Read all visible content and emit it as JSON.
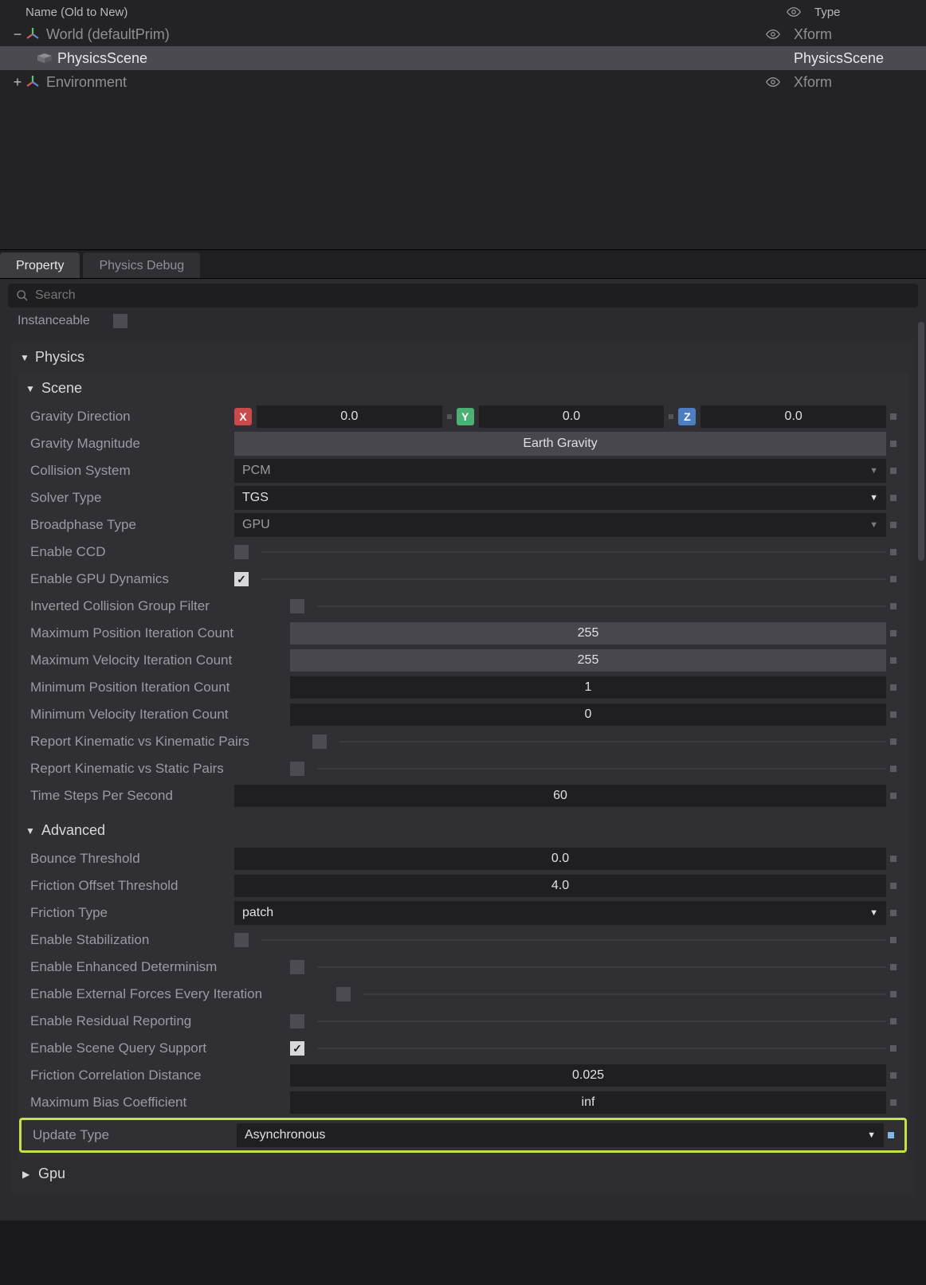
{
  "outliner": {
    "header_name": "Name (Old to New)",
    "header_type": "Type",
    "rows": [
      {
        "label": "World (defaultPrim)",
        "type": "Xform",
        "selected": false,
        "expand": "−",
        "icon": "axes",
        "vis": true
      },
      {
        "label": "PhysicsScene",
        "type": "PhysicsScene",
        "selected": true,
        "expand": "",
        "icon": "cube",
        "vis": false
      },
      {
        "label": "Environment",
        "type": "Xform",
        "selected": false,
        "expand": "+",
        "icon": "axes",
        "vis": true
      }
    ]
  },
  "tabs": {
    "property": "Property",
    "physics_debug": "Physics Debug"
  },
  "search_placeholder": "Search",
  "instanceable_label": "Instanceable",
  "physics_section": "Physics",
  "scene_section": "Scene",
  "gravity_direction": {
    "label": "Gravity Direction",
    "x": "0.0",
    "y": "0.0",
    "z": "0.0"
  },
  "gravity_magnitude": {
    "label": "Gravity Magnitude",
    "button": "Earth Gravity"
  },
  "collision_system": {
    "label": "Collision System",
    "value": "PCM"
  },
  "solver_type": {
    "label": "Solver Type",
    "value": "TGS"
  },
  "broadphase_type": {
    "label": "Broadphase Type",
    "value": "GPU"
  },
  "enable_ccd": {
    "label": "Enable CCD",
    "checked": false
  },
  "enable_gpu_dynamics": {
    "label": "Enable GPU Dynamics",
    "checked": true
  },
  "inverted_collision": {
    "label": "Inverted Collision Group Filter",
    "checked": false
  },
  "max_pos_iter": {
    "label": "Maximum Position Iteration Count",
    "value": "255"
  },
  "max_vel_iter": {
    "label": "Maximum Velocity Iteration Count",
    "value": "255"
  },
  "min_pos_iter": {
    "label": "Minimum Position Iteration Count",
    "value": "1"
  },
  "min_vel_iter": {
    "label": "Minimum Velocity Iteration Count",
    "value": "0"
  },
  "report_kk": {
    "label": "Report Kinematic vs Kinematic Pairs",
    "checked": false
  },
  "report_ks": {
    "label": "Report Kinematic vs Static Pairs",
    "checked": false
  },
  "timesteps": {
    "label": "Time Steps Per Second",
    "value": "60"
  },
  "advanced_section": "Advanced",
  "bounce_threshold": {
    "label": "Bounce Threshold",
    "value": "0.0"
  },
  "friction_offset": {
    "label": "Friction Offset Threshold",
    "value": "4.0"
  },
  "friction_type": {
    "label": "Friction Type",
    "value": "patch"
  },
  "enable_stabilization": {
    "label": "Enable Stabilization",
    "checked": false
  },
  "enable_enhanced_det": {
    "label": "Enable Enhanced Determinism",
    "checked": false
  },
  "enable_ext_forces": {
    "label": "Enable External Forces Every Iteration",
    "checked": false
  },
  "enable_residual": {
    "label": "Enable Residual Reporting",
    "checked": false
  },
  "enable_scene_query": {
    "label": "Enable Scene Query Support",
    "checked": true
  },
  "friction_corr_dist": {
    "label": "Friction Correlation Distance",
    "value": "0.025"
  },
  "max_bias_coef": {
    "label": "Maximum Bias Coefficient",
    "value": "inf"
  },
  "update_type": {
    "label": "Update Type",
    "value": "Asynchronous"
  },
  "gpu_section": "Gpu"
}
